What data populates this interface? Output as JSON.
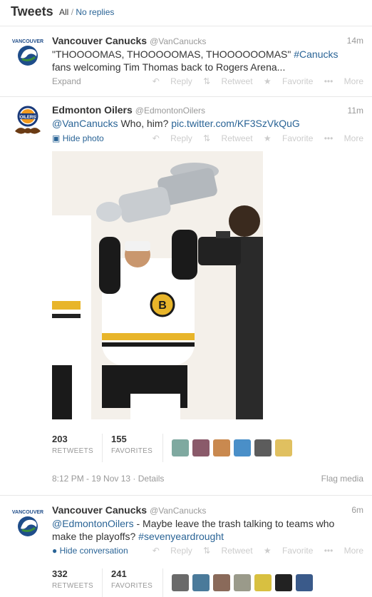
{
  "header": {
    "title": "Tweets",
    "filter_all": "All",
    "filter_sep": "/",
    "filter_noreplies": "No replies"
  },
  "actions": {
    "reply": "Reply",
    "retweet": "Retweet",
    "favorite": "Favorite",
    "more": "More"
  },
  "tweets": [
    {
      "name": "Vancouver Canucks",
      "handle": "@VanCanucks",
      "time": "14m",
      "text_pre": "\"THOOOOMAS, THOOOOOMAS, THOOOOOOMAS\" ",
      "hashtag": "#Canucks",
      "text_post": " fans welcoming Tim Thomas back to Rogers Arena...",
      "expand": "Expand"
    },
    {
      "name": "Edmonton Oilers",
      "handle": "@EdmontonOilers",
      "time": "11m",
      "mention": "@VanCanucks",
      "text_mid": " Who, him? ",
      "link": "pic.twitter.com/KF3SzVkQuG",
      "hide_photo": "Hide photo",
      "retweets": "203",
      "retweets_label": "RETWEETS",
      "favorites": "155",
      "favorites_label": "FAVORITES",
      "date": "8:12 PM - 19 Nov 13",
      "details": " · Details",
      "flag": "Flag media"
    },
    {
      "name": "Vancouver Canucks",
      "handle": "@VanCanucks",
      "time": "6m",
      "mention": "@EdmontonOilers",
      "text_post": " - Maybe leave the trash talking to teams who make the playoffs? ",
      "hashtag": "#sevenyeardrought",
      "hide_conv": "Hide conversation",
      "retweets": "332",
      "retweets_label": "RETWEETS",
      "favorites": "241",
      "favorites_label": "FAVORITES"
    }
  ],
  "colors": {
    "link": "#2a6496",
    "muted": "#999999",
    "text": "#333333"
  }
}
